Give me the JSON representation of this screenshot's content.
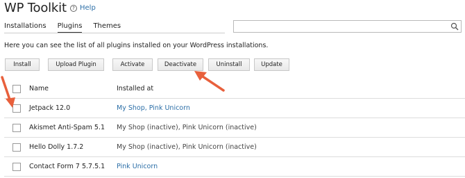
{
  "app": {
    "title": "WP Toolkit",
    "help_label": "Help"
  },
  "tabs": [
    {
      "label": "Installations",
      "active": false
    },
    {
      "label": "Plugins",
      "active": true
    },
    {
      "label": "Themes",
      "active": false
    }
  ],
  "search": {
    "placeholder": "",
    "value": ""
  },
  "description": "Here you can see the list of all plugins installed on your WordPress installations.",
  "toolbar": {
    "install": "Install",
    "upload_plugin": "Upload Plugin",
    "activate": "Activate",
    "deactivate": "Deactivate",
    "uninstall": "Uninstall",
    "update": "Update"
  },
  "table": {
    "col_name": "Name",
    "col_installed_at": "Installed at",
    "rows": [
      {
        "name": "Jetpack 12.0",
        "installed_at": "My Shop, Pink Unicorn",
        "link": true
      },
      {
        "name": "Akismet Anti-Spam 5.1",
        "installed_at": "My Shop (inactive), Pink Unicorn (inactive)",
        "link": false
      },
      {
        "name": "Hello Dolly 1.7.2",
        "installed_at": "My Shop (inactive), Pink Unicorn (inactive)",
        "link": false
      },
      {
        "name": "Contact Form 7 5.7.5.1",
        "installed_at": "Pink Unicorn",
        "link": true
      }
    ]
  },
  "colors": {
    "link": "#2b6ea7",
    "annotation_arrow": "#e8603c"
  }
}
